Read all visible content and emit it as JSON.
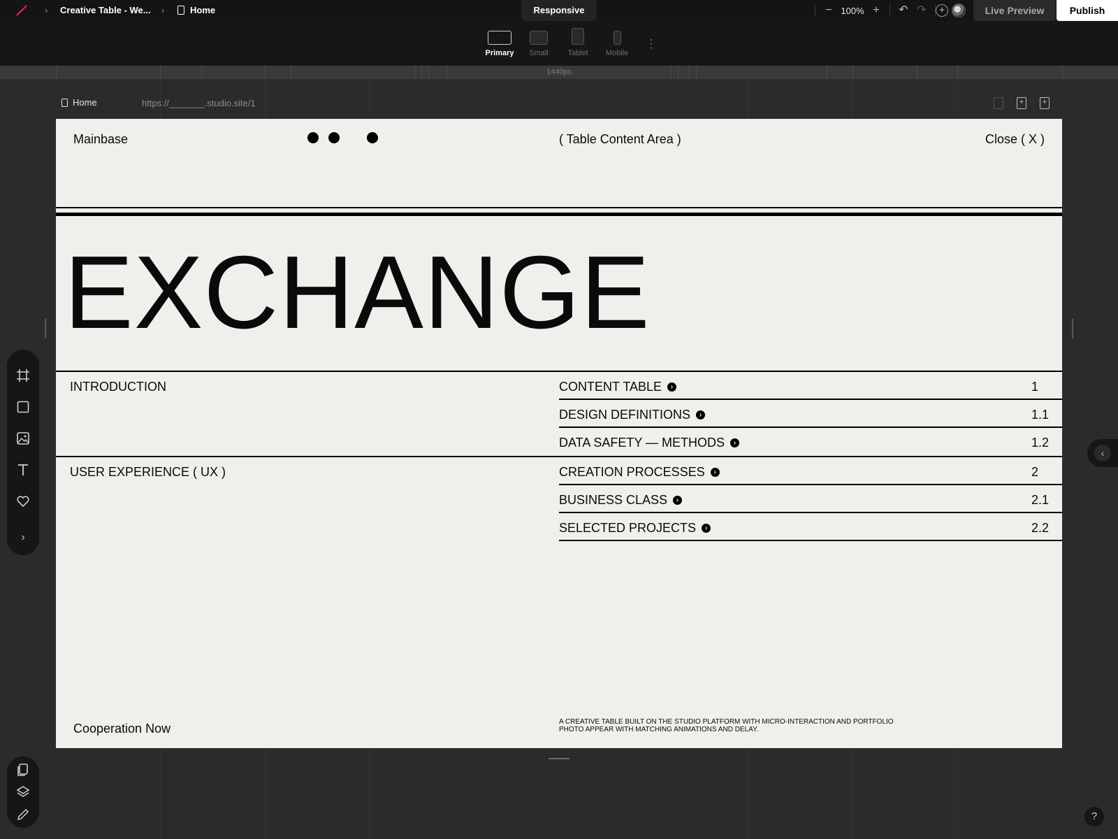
{
  "topbar": {
    "project_name": "Creative Table - We...",
    "page_name": "Home",
    "mode_tab": "Responsive",
    "zoom": "100%",
    "live_preview_label": "Live Preview",
    "publish_label": "Publish"
  },
  "devices": [
    {
      "label": "Primary",
      "active": true
    },
    {
      "label": "Small",
      "active": false
    },
    {
      "label": "Tablet",
      "active": false
    },
    {
      "label": "Mobile",
      "active": false
    }
  ],
  "ruler": {
    "width_label": "1440px"
  },
  "page_header": {
    "page_label": "Home",
    "url": "https://_______.studio.site/1"
  },
  "artboard": {
    "nav": {
      "left": "Mainbase",
      "center": "( Table Content Area )",
      "right": "Close ( X )"
    },
    "hero_title": "EXCHANGE",
    "sections": [
      {
        "title": "INTRODUCTION",
        "items": [
          {
            "label": "CONTENT TABLE",
            "num": "1"
          },
          {
            "label": "DESIGN DEFINITIONS",
            "num": "1.1"
          },
          {
            "label": "DATA SAFETY — METHODS",
            "num": "1.2"
          }
        ]
      },
      {
        "title": "USER EXPERIENCE ( UX )",
        "items": [
          {
            "label": "CREATION PROCESSES",
            "num": "2"
          },
          {
            "label": "BUSINESS CLASS",
            "num": "2.1"
          },
          {
            "label": "SELECTED PROJECTS",
            "num": "2.2"
          }
        ]
      }
    ],
    "footer_left": "Cooperation Now",
    "footer_right": "A CREATIVE TABLE BUILT ON THE STUDIO PLATFORM WITH MICRO-INTERACTION AND PORTFOLIO PHOTO APPEAR WITH MATCHING ANIMATIONS AND DELAY."
  },
  "tools": [
    "frame-icon",
    "rectangle-icon",
    "image-icon",
    "text-icon",
    "heart-icon",
    "chevron-right-icon"
  ],
  "bottom_tools": [
    "pages-icon",
    "layers-icon",
    "pen-icon"
  ],
  "help_label": "?",
  "colors": {
    "chrome_dark": "#141414",
    "canvas_bg": "#2b2b2b",
    "artboard_bg": "#f0efeb",
    "brand_accent": "#e0207a",
    "publish_bg": "#ffffff"
  }
}
